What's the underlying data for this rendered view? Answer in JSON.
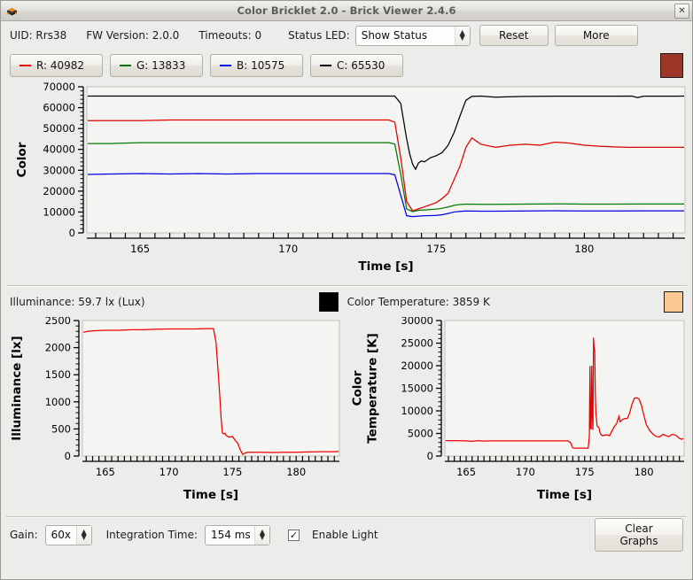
{
  "window": {
    "title": "Color Bricklet 2.0 - Brick Viewer 2.4.6",
    "icon": "brick-icon",
    "close_label": "✕"
  },
  "header": {
    "uid_label": "UID: Rrs38",
    "fw_label": "FW Version: 2.0.0",
    "timeouts_label": "Timeouts: 0",
    "status_led_label": "Status LED:",
    "status_led_value": "Show Status",
    "reset_label": "Reset",
    "more_label": "More"
  },
  "legend": {
    "items": [
      {
        "label": "R: 40982",
        "color": "#e00000"
      },
      {
        "label": "G: 13833",
        "color": "#007a00"
      },
      {
        "label": "B: 10575",
        "color": "#0000e6"
      },
      {
        "label": "C: 65530",
        "color": "#000000"
      }
    ],
    "color_swatch": "#9e3529"
  },
  "status": {
    "illuminance_label": "Illuminance: 59.7 lx (Lux)",
    "illuminance_swatch": "#000000",
    "color_temperature_label": "Color Temperature: 3859 K",
    "color_temperature_swatch": "#fbc893"
  },
  "bottom": {
    "gain_label": "Gain:",
    "gain_value": "60x",
    "integration_label": "Integration Time:",
    "integration_value": "154 ms",
    "enable_light_label": "Enable Light",
    "enable_light_checked": true,
    "check_glyph": "✓",
    "clear_graphs_label": "Clear Graphs"
  },
  "chart_data": [
    {
      "id": "color",
      "type": "line",
      "title": "",
      "xlabel": "Time [s]",
      "ylabel": "Color",
      "xlim": [
        163.2,
        183.4
      ],
      "ylim": [
        0,
        70000
      ],
      "xticks": [
        165,
        170,
        175,
        180
      ],
      "yticks": [
        0,
        10000,
        20000,
        30000,
        40000,
        50000,
        60000,
        70000
      ],
      "grid": false,
      "legend_position": "top-external",
      "series": [
        {
          "name": "C",
          "color": "#000000",
          "x": [
            163.2,
            164,
            165,
            166,
            167,
            168,
            169,
            170,
            171,
            172,
            173,
            173.4,
            173.6,
            173.8,
            174,
            174.1,
            174.2,
            174.3,
            174.4,
            174.5,
            174.6,
            174.7,
            174.8,
            175,
            175.2,
            175.4,
            175.6,
            175.8,
            176,
            176.2,
            176.5,
            177,
            177.5,
            178,
            179,
            180,
            181,
            181.6,
            181.8,
            182,
            183,
            183.4
          ],
          "y": [
            65530,
            65530,
            65530,
            65530,
            65530,
            65530,
            65530,
            65530,
            65530,
            65530,
            65530,
            65530,
            65530,
            62000,
            45000,
            38000,
            33000,
            30500,
            33500,
            34500,
            34000,
            35000,
            36000,
            37000,
            38500,
            42000,
            48000,
            56000,
            63500,
            65400,
            65530,
            65000,
            65200,
            65400,
            65500,
            65500,
            65500,
            65530,
            64800,
            65500,
            65500,
            65530
          ]
        },
        {
          "name": "R",
          "color": "#e00000",
          "x": [
            163.2,
            164,
            165,
            166,
            167,
            168,
            169,
            170,
            171,
            172,
            173,
            173.4,
            173.6,
            173.8,
            174,
            174.2,
            174.4,
            174.6,
            174.8,
            175,
            175.2,
            175.4,
            175.6,
            175.8,
            176,
            176.2,
            176.5,
            177,
            177.5,
            178,
            178.5,
            179,
            179.5,
            180,
            180.5,
            181,
            181.5,
            182,
            183,
            183.4
          ],
          "y": [
            53800,
            53800,
            53800,
            54100,
            54100,
            54100,
            54100,
            54100,
            54100,
            54100,
            54100,
            54100,
            53000,
            36000,
            15000,
            10500,
            11500,
            12500,
            13500,
            14500,
            16500,
            19000,
            25500,
            32000,
            41000,
            45500,
            42500,
            41000,
            42000,
            42500,
            42000,
            43500,
            43000,
            42000,
            41500,
            41200,
            41000,
            40982,
            40982,
            40982
          ]
        },
        {
          "name": "G",
          "color": "#007a00",
          "x": [
            163.2,
            164,
            165,
            166,
            167,
            168,
            169,
            170,
            171,
            172,
            173,
            173.4,
            173.6,
            173.8,
            174,
            174.2,
            174.4,
            174.6,
            174.8,
            175,
            175.2,
            175.4,
            175.6,
            175.8,
            176,
            176.5,
            177,
            178,
            179,
            180,
            181,
            182,
            183,
            183.4
          ],
          "y": [
            42800,
            42800,
            43200,
            43200,
            43200,
            43200,
            43200,
            43200,
            43200,
            43200,
            43200,
            43200,
            42500,
            28000,
            11500,
            10200,
            10800,
            11000,
            11200,
            11400,
            11800,
            12400,
            13200,
            13600,
            13800,
            13700,
            13700,
            13800,
            13900,
            13800,
            13800,
            13833,
            13833,
            13833
          ]
        },
        {
          "name": "B",
          "color": "#0000e6",
          "x": [
            163.2,
            164,
            165,
            166,
            167,
            168,
            169,
            170,
            171,
            172,
            173,
            173.4,
            173.6,
            173.8,
            174,
            174.2,
            174.4,
            174.6,
            174.8,
            175,
            175.2,
            175.4,
            175.6,
            175.8,
            176,
            176.5,
            177,
            178,
            179,
            180,
            181,
            182,
            183,
            183.4
          ],
          "y": [
            28000,
            28200,
            28400,
            28200,
            28400,
            28200,
            28400,
            28400,
            28400,
            28400,
            28400,
            28400,
            27800,
            18000,
            8200,
            7800,
            8000,
            8200,
            8300,
            8400,
            8700,
            9300,
            10000,
            10300,
            10500,
            10400,
            10400,
            10500,
            10600,
            10500,
            10500,
            10575,
            10575,
            10575
          ]
        }
      ]
    },
    {
      "id": "illuminance",
      "type": "line",
      "title": "",
      "xlabel": "Time [s]",
      "ylabel": "Illuminance [lx]",
      "xlim": [
        163.2,
        183.4
      ],
      "ylim": [
        0,
        2500
      ],
      "xticks": [
        165,
        170,
        175,
        180
      ],
      "yticks": [
        0,
        500,
        1000,
        1500,
        2000,
        2500
      ],
      "grid": false,
      "series": [
        {
          "name": "Illuminance",
          "color": "#ee0000",
          "x": [
            163.2,
            163.6,
            164,
            165,
            166,
            167,
            168,
            169,
            170,
            171,
            172,
            173,
            173.5,
            173.7,
            173.8,
            173.9,
            174,
            174.1,
            174.2,
            174.3,
            174.4,
            174.5,
            174.7,
            175,
            175.2,
            175.4,
            175.6,
            175.8,
            176,
            176.2,
            176.5,
            177,
            178,
            179,
            180,
            181,
            182,
            183,
            183.4
          ],
          "y": [
            2280,
            2300,
            2310,
            2320,
            2320,
            2330,
            2330,
            2340,
            2345,
            2345,
            2345,
            2350,
            2350,
            2100,
            1780,
            1450,
            1100,
            700,
            430,
            410,
            420,
            380,
            350,
            360,
            290,
            240,
            120,
            30,
            55,
            70,
            70,
            70,
            65,
            70,
            70,
            75,
            80,
            80,
            85
          ]
        }
      ]
    },
    {
      "id": "color_temperature",
      "type": "line",
      "title": "",
      "xlabel": "Time [s]",
      "ylabel": "Color Temperature [K]",
      "xlim": [
        163.2,
        183.4
      ],
      "ylim": [
        0,
        30000
      ],
      "xticks": [
        165,
        170,
        175,
        180
      ],
      "yticks": [
        0,
        5000,
        10000,
        15000,
        20000,
        25000,
        30000
      ],
      "grid": false,
      "series": [
        {
          "name": "Color Temperature",
          "color": "#ee0000",
          "x": [
            163.2,
            164,
            165,
            165.5,
            166,
            166.5,
            167,
            168,
            169,
            170,
            171,
            172,
            173,
            173.6,
            173.8,
            174,
            174.2,
            175,
            175.3,
            175.4,
            175.45,
            175.5,
            175.55,
            175.6,
            175.65,
            175.7,
            175.75,
            175.8,
            175.85,
            175.9,
            175.95,
            176,
            176.05,
            176.1,
            176.2,
            176.3,
            176.4,
            176.5,
            176.7,
            176.9,
            177.1,
            177.3,
            177.5,
            177.7,
            177.9,
            178,
            178.2,
            178.4,
            178.6,
            178.8,
            179,
            179.2,
            179.4,
            179.6,
            179.8,
            180,
            180.2,
            180.5,
            180.8,
            181,
            181.3,
            181.6,
            181.9,
            182.1,
            182.4,
            182.7,
            183,
            183.2,
            183.4
          ],
          "y": [
            3400,
            3400,
            3350,
            3250,
            3400,
            3300,
            3350,
            3350,
            3350,
            3350,
            3350,
            3350,
            3350,
            3350,
            3000,
            1800,
            1750,
            1750,
            1750,
            4500,
            19900,
            6200,
            5900,
            20000,
            9000,
            5800,
            26200,
            24000,
            23500,
            14000,
            9500,
            8200,
            6700,
            6500,
            6300,
            5200,
            4700,
            4500,
            4600,
            4700,
            4500,
            5500,
            6500,
            7200,
            8800,
            7600,
            8100,
            8300,
            8300,
            9500,
            11500,
            12800,
            12900,
            12600,
            11200,
            9000,
            7000,
            5600,
            4800,
            4400,
            4200,
            4800,
            4500,
            4300,
            4800,
            4600,
            3900,
            3700,
            4000
          ]
        }
      ]
    }
  ]
}
